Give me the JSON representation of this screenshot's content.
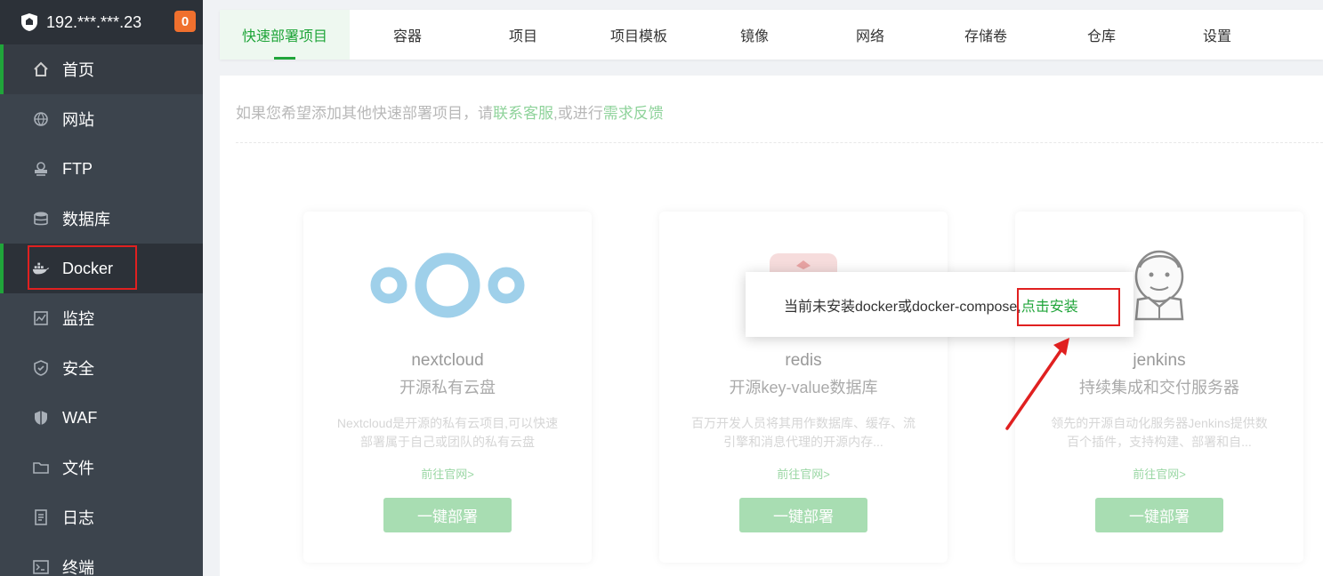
{
  "sidebar": {
    "server": "192.***.***.23",
    "badge": "0",
    "items": [
      {
        "label": "首页",
        "icon": "home-icon"
      },
      {
        "label": "网站",
        "icon": "globe-icon"
      },
      {
        "label": "FTP",
        "icon": "ftp-icon"
      },
      {
        "label": "数据库",
        "icon": "database-icon"
      },
      {
        "label": "Docker",
        "icon": "docker-icon"
      },
      {
        "label": "监控",
        "icon": "monitor-icon"
      },
      {
        "label": "安全",
        "icon": "shield-check-icon"
      },
      {
        "label": "WAF",
        "icon": "waf-shield-icon"
      },
      {
        "label": "文件",
        "icon": "folder-icon"
      },
      {
        "label": "日志",
        "icon": "log-icon"
      },
      {
        "label": "终端",
        "icon": "terminal-icon"
      }
    ]
  },
  "tabs": [
    "快速部署项目",
    "容器",
    "项目",
    "项目模板",
    "镜像",
    "网络",
    "存储卷",
    "仓库",
    "设置"
  ],
  "tip": {
    "prefix": "如果您希望添加其他快速部署项目，请",
    "link1": "联系客服",
    "middle": ",或进行",
    "link2": "需求反馈"
  },
  "cards": [
    {
      "name": "nextcloud",
      "subtitle": "开源私有云盘",
      "desc": "Nextcloud是开源的私有云项目,可以快速部署属于自己或团队的私有云盘",
      "site": "前往官网>",
      "button": "一键部署"
    },
    {
      "name": "redis",
      "subtitle": "开源key-value数据库",
      "desc": "百万开发人员将其用作数据库、缓存、流引擎和消息代理的开源内存...",
      "site": "前往官网>",
      "button": "一键部署"
    },
    {
      "name": "jenkins",
      "subtitle": "持续集成和交付服务器",
      "desc": "领先的开源自动化服务器Jenkins提供数百个插件，支持构建、部署和自...",
      "site": "前往官网>",
      "button": "一键部署"
    }
  ],
  "popup": {
    "text": "当前未安装docker或docker-compose,",
    "action": "点击安装"
  },
  "colors": {
    "accent": "#20a53a",
    "sidebar": "#3c444d",
    "annotation": "#e02020"
  }
}
